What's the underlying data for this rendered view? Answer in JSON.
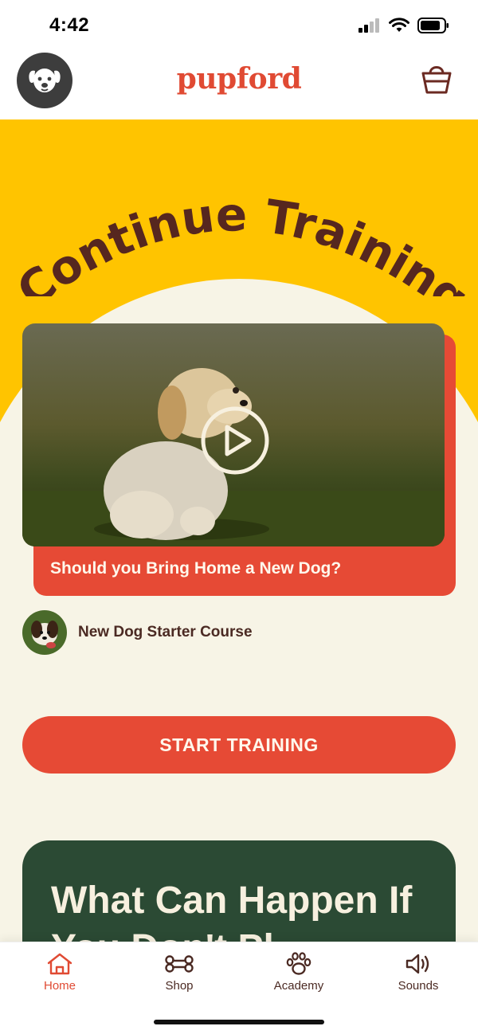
{
  "status_bar": {
    "time": "4:42"
  },
  "header": {
    "brand": "pupford",
    "avatar_icon": "dog-face-icon",
    "cart_icon": "basket-icon"
  },
  "hero": {
    "title": "Continue Training",
    "video": {
      "caption": "Should you Bring Home a New Dog?",
      "play_icon": "play-icon"
    },
    "course": {
      "label": "New Dog Starter Course"
    },
    "cta": "START TRAINING"
  },
  "promo": {
    "text": "What Can Happen If You Don't Pl"
  },
  "tabs": [
    {
      "label": "Home",
      "icon": "home-icon",
      "active": true
    },
    {
      "label": "Shop",
      "icon": "bone-icon",
      "active": false
    },
    {
      "label": "Academy",
      "icon": "paw-icon",
      "active": false
    },
    {
      "label": "Sounds",
      "icon": "speaker-icon",
      "active": false
    }
  ],
  "colors": {
    "brand": "#e04a33",
    "yellow": "#ffc400",
    "cream": "#f7f4e6",
    "green": "#2b4a34",
    "text_brown": "#4b2a23"
  }
}
